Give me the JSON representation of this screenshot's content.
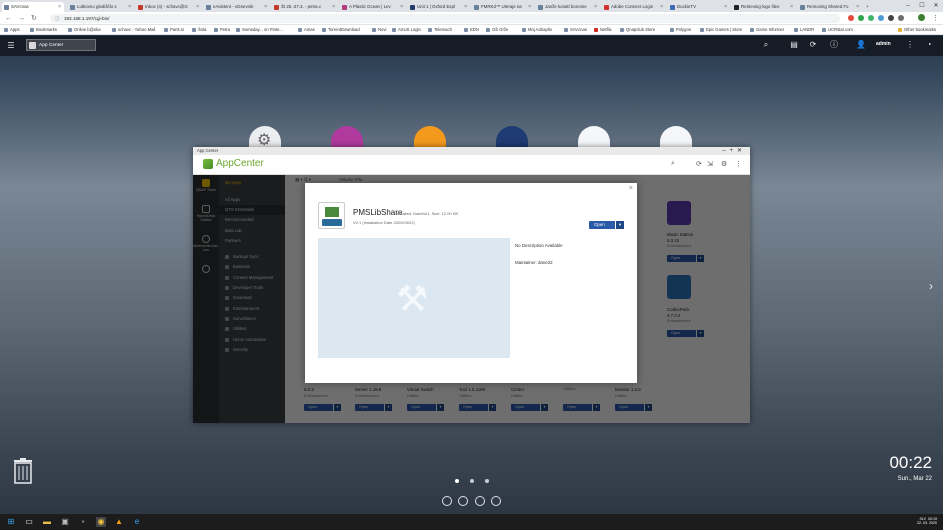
{
  "browser": {
    "tabs": [
      {
        "label": "SAVcnas"
      },
      {
        "label": "Lutkovno glediščlo s"
      },
      {
        "label": "Inbox (4) - schavc@G"
      },
      {
        "label": "eAsistent - eDnevnik"
      },
      {
        "label": "Št 25.-27.3. - petra.c"
      },
      {
        "label": "A Plastic Ocean | Lev"
      },
      {
        "label": "Unit 1 | Oxford Expl"
      },
      {
        "label": "FMRKd™ Uteraje na"
      },
      {
        "label": "Janže korakl bonome"
      },
      {
        "label": "Adobe Connect Login"
      },
      {
        "label": "DuckieTV"
      },
      {
        "label": "Retrieving logo files"
      },
      {
        "label": "Removing Shared Fo"
      }
    ],
    "url": "192.168.1.197/cgi-bin/",
    "bookmarks": [
      "Apps",
      "Bookmarks",
      "Online b@nka",
      "schavc - Yahoo Mail",
      "Parts.si",
      "Šola",
      "Petra",
      "Someday... on Pinte...",
      "Amas",
      "TorrentDownload",
      "Novi",
      "ASUS Login",
      "Telemach",
      "EDN",
      "OŠ Grže",
      "Moj Adriaplin",
      "SAVcnas",
      "Netflix",
      "Qnapclub Store",
      "Polygon",
      "Epic Games | Store",
      "Game Informer",
      "LANDR",
      "UCRstar.com",
      "Other bookmarks"
    ]
  },
  "qts": {
    "taskbar_app": "App Center",
    "user": "admin"
  },
  "appcenter": {
    "window_title": "App Center",
    "header_title": "AppCenter",
    "rail": [
      "QNAP Store",
      "HybridDesk Station",
      "Multimedia Add-ons"
    ],
    "menu": {
      "my_apps": "My Apps",
      "top": [
        "All Apps",
        "QTS Essentials",
        "Recommended",
        "Beta Lab",
        "Partners"
      ],
      "categories": [
        "Backup/ Sync",
        "Business",
        "Content Management",
        "Developer Tools",
        "Download",
        "Entertainment",
        "Surveillance",
        "Utilities",
        "Home Automation",
        "Security"
      ]
    },
    "toolbar": {
      "volume_info": "Volume Info"
    },
    "visible_apps": [
      {
        "name": "Music Station",
        "version": "5.3.10",
        "category": "Entertainment",
        "open": "Open"
      },
      {
        "name": "CodexPack",
        "version": "4.7.0.2",
        "category": "Entertainment",
        "open": "Open"
      }
    ],
    "bottom_row": [
      {
        "name": "6.0.3",
        "category": "Entertainment",
        "open": "Open"
      },
      {
        "name": "Server 1.18.8",
        "category": "Entertainment",
        "open": "Open"
      },
      {
        "name": "Virtual Switch",
        "category": "Utilities",
        "open": "Open"
      },
      {
        "name": "Tool 1.0.1185",
        "category": "Utilities",
        "open": "Open"
      },
      {
        "name": "Center",
        "category": "Utilities",
        "open": "Open"
      },
      {
        "name": "",
        "category": "Utilities",
        "open": "Open"
      },
      {
        "name": "Monitor 1.2.0",
        "category": "Utilities",
        "open": "Open"
      }
    ]
  },
  "modal": {
    "app_name": "PMSLibShare",
    "installed": "Installed: DataVol1, Size: 12.00 KB",
    "version_line": "V0.1 (Installation Date 2020/03/22)",
    "open_label": "Open",
    "description": "No Description Available",
    "maintainer_label": "Maintainer:",
    "maintainer": "dane22"
  },
  "desktop": {
    "time": "00:22",
    "date": "Sun., Mar 22"
  },
  "win_tray": {
    "lang": "SLV",
    "time": "00:19",
    "date": "22. 03. 2020"
  }
}
